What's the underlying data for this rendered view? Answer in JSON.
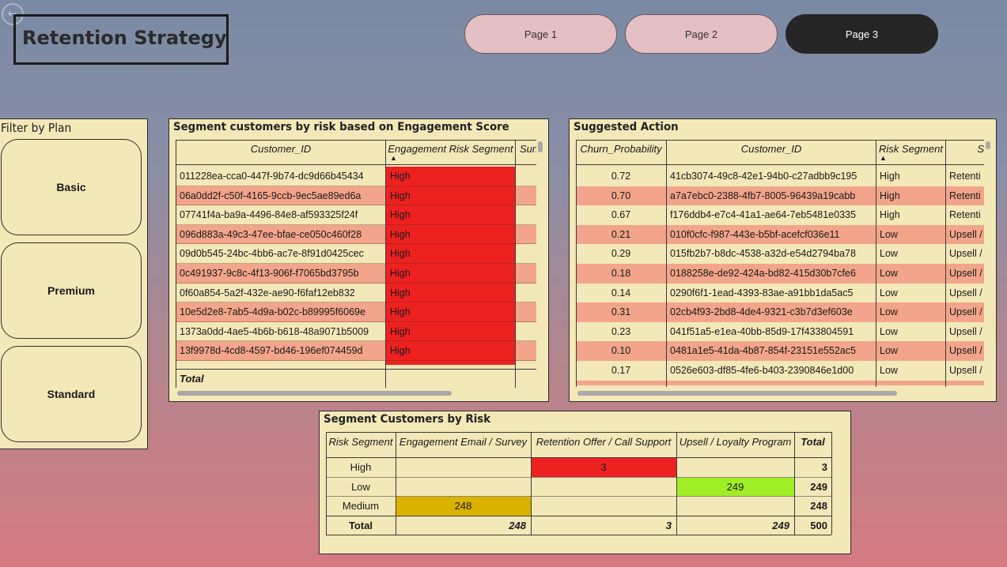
{
  "title": "Retention Strategy",
  "nav": [
    "Page 1",
    "Page 2",
    "Page 3"
  ],
  "filter": {
    "title": "Filter by Plan",
    "options": [
      "Basic",
      "Premium",
      "Standard"
    ]
  },
  "engagement_table": {
    "title": "Segment customers by risk based on Engagement Score",
    "columns": [
      "Customer_ID",
      "Engagement Risk Segment",
      "Sun"
    ],
    "rows": [
      {
        "id": "011228ea-cca0-447f-9b74-dc9d66b45434",
        "segment": "High"
      },
      {
        "id": "06a0dd2f-c50f-4165-9ccb-9ec5ae89ed6a",
        "segment": "High"
      },
      {
        "id": "07741f4a-ba9a-4496-84e8-af593325f24f",
        "segment": "High"
      },
      {
        "id": "096d883a-49c3-47ee-bfae-ce050c460f28",
        "segment": "High"
      },
      {
        "id": "09d0b545-24bc-4bb6-ac7e-8f91d0425cec",
        "segment": "High"
      },
      {
        "id": "0c491937-9c8c-4f13-906f-f7065bd3795b",
        "segment": "High"
      },
      {
        "id": "0f60a854-5a2f-432e-ae90-f6faf12eb832",
        "segment": "High"
      },
      {
        "id": "10e5d2e8-7ab5-4d9a-b02c-b89995f6069e",
        "segment": "High"
      },
      {
        "id": "1373a0dd-4ae5-4b6b-b618-48a9071b5009",
        "segment": "High"
      },
      {
        "id": "13f9978d-4cd8-4597-bd46-196ef074459d",
        "segment": "High"
      }
    ],
    "total_label": "Total"
  },
  "action_table": {
    "title": "Suggested Action",
    "columns": [
      "Churn_Probability",
      "Customer_ID",
      "Risk Segment",
      "S"
    ],
    "rows": [
      {
        "prob": "0.72",
        "id": "41cb3074-49c8-42e1-94b0-c27adbb9c195",
        "seg": "High",
        "action": "Retenti"
      },
      {
        "prob": "0.70",
        "id": "a7a7ebc0-2388-4fb7-8005-96439a19cabb",
        "seg": "High",
        "action": "Retenti"
      },
      {
        "prob": "0.67",
        "id": "f176ddb4-e7c4-41a1-ae64-7eb5481e0335",
        "seg": "High",
        "action": "Retenti"
      },
      {
        "prob": "0.21",
        "id": "010f0cfc-f987-443e-b5bf-acefcf036e11",
        "seg": "Low",
        "action": "Upsell /"
      },
      {
        "prob": "0.29",
        "id": "015fb2b7-b8dc-4538-a32d-e54d2794ba78",
        "seg": "Low",
        "action": "Upsell /"
      },
      {
        "prob": "0.18",
        "id": "0188258e-de92-424a-bd82-415d30b7cfe6",
        "seg": "Low",
        "action": "Upsell /"
      },
      {
        "prob": "0.14",
        "id": "0290f6f1-1ead-4393-83ae-a91bb1da5ac5",
        "seg": "Low",
        "action": "Upsell /"
      },
      {
        "prob": "0.31",
        "id": "02cb4f93-2bd8-4de4-9321-c3b7d3ef603e",
        "seg": "Low",
        "action": "Upsell /"
      },
      {
        "prob": "0.23",
        "id": "041f51a5-e1ea-40bb-85d9-17f433804591",
        "seg": "Low",
        "action": "Upsell /"
      },
      {
        "prob": "0.10",
        "id": "0481a1e5-41da-4b87-854f-23151e552ac5",
        "seg": "Low",
        "action": "Upsell /"
      },
      {
        "prob": "0.17",
        "id": "0526e603-df85-4fe6-b403-2390846e1d00",
        "seg": "Low",
        "action": "Upsell /"
      }
    ]
  },
  "matrix": {
    "title": "Segment Customers by Risk",
    "columns": [
      "Risk Segment",
      "Engagement Email / Survey",
      "Retention Offer / Call Support",
      "Upsell / Loyalty Program",
      "Total"
    ],
    "rows": [
      {
        "label": "High",
        "values": [
          "",
          "3",
          ""
        ],
        "total": "3"
      },
      {
        "label": "Low",
        "values": [
          "",
          "",
          "249"
        ],
        "total": "249"
      },
      {
        "label": "Medium",
        "values": [
          "248",
          "",
          ""
        ],
        "total": "248"
      }
    ],
    "total_row": {
      "label": "Total",
      "values": [
        "248",
        "3",
        "249"
      ],
      "total": "500"
    }
  },
  "colors": {
    "panel_bg": "#f3e8b8",
    "high_red": "#ee2121",
    "row_salmon": "#f2a58a",
    "low_green": "#a0ee26",
    "medium_gold": "#dcb200",
    "active_nav": "#252525",
    "inactive_nav": "#e4c0c4"
  }
}
